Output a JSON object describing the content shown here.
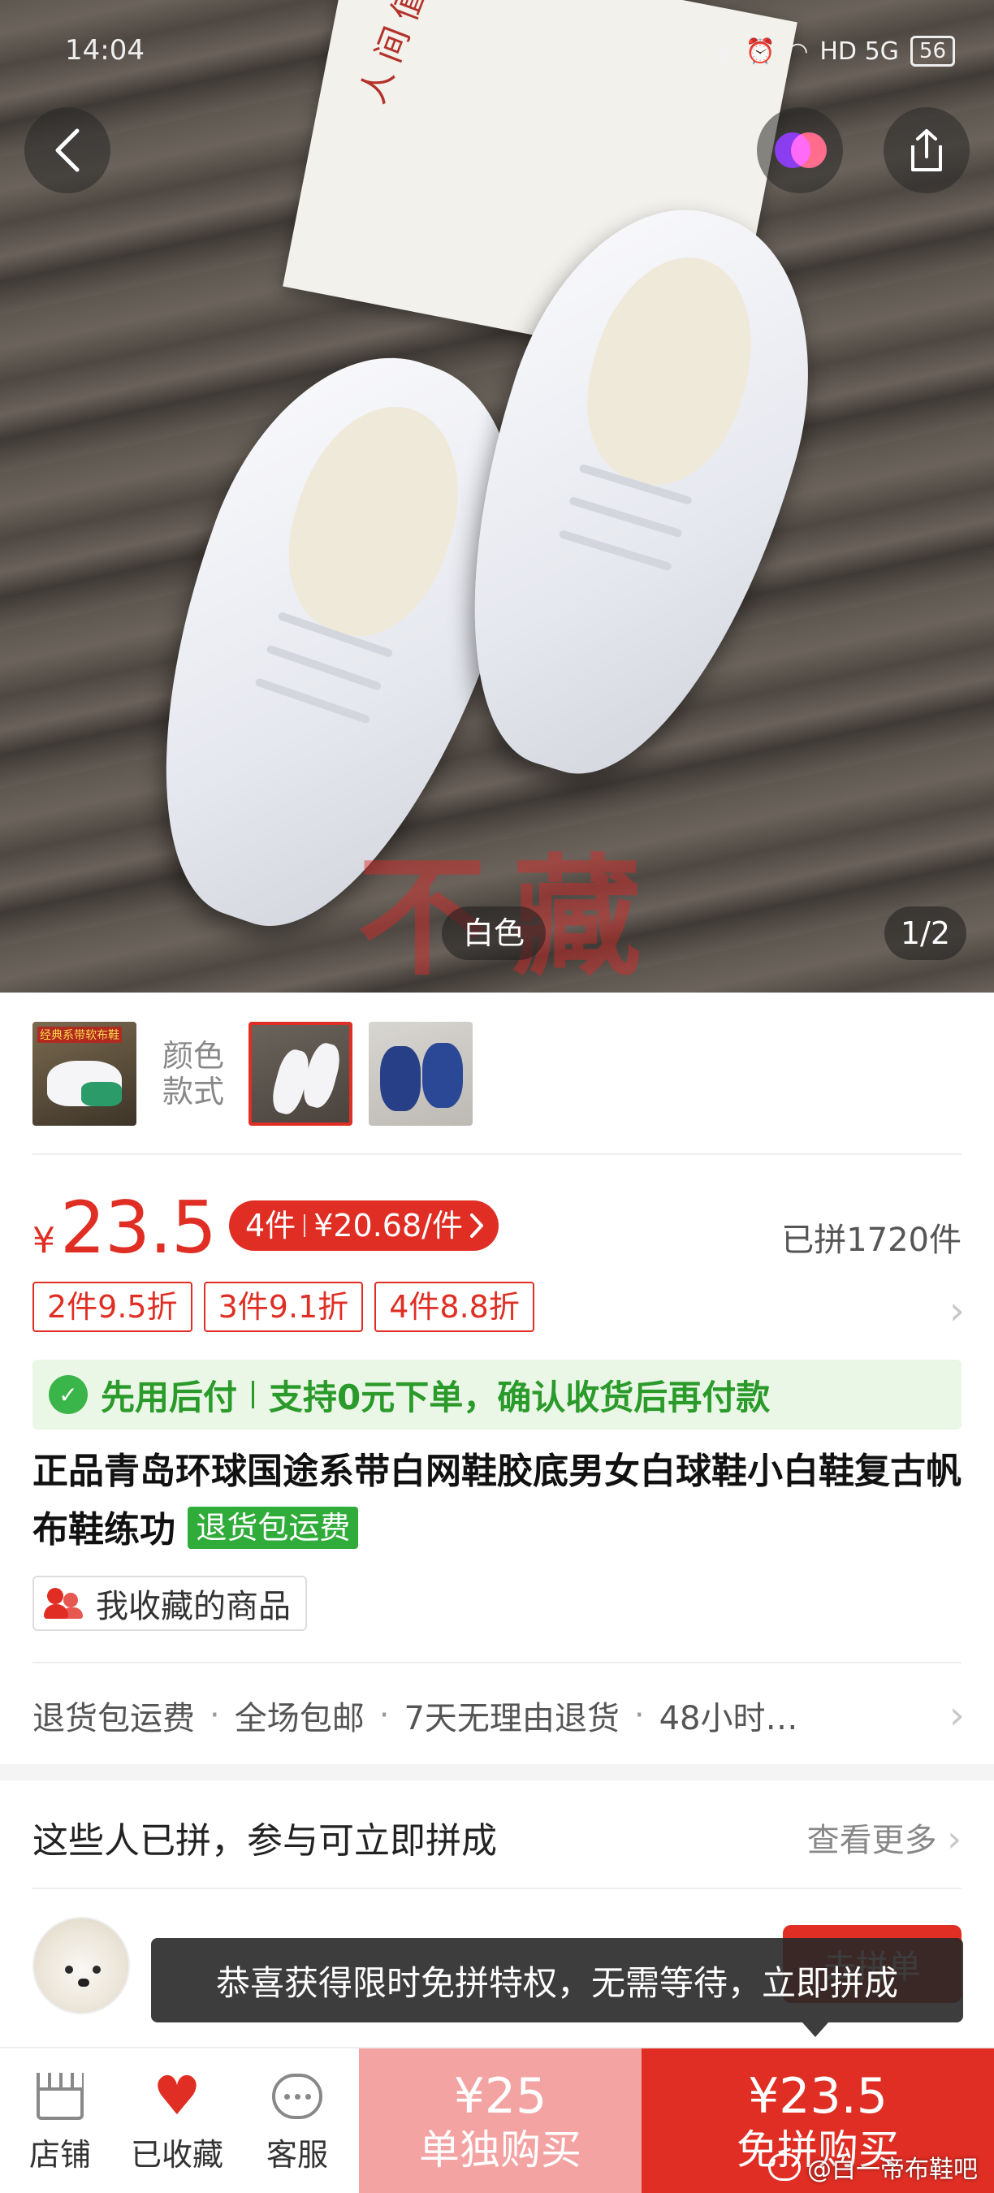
{
  "status_bar": {
    "time": "14:04",
    "network": "HD 5G",
    "battery": "56"
  },
  "hero": {
    "color_tag": "白色",
    "page_indicator": "1/2",
    "watermark": "不藏",
    "book_title": "人间值得"
  },
  "variants": {
    "label": "颜色\n款式",
    "thumb1_caption": "经典系带软布鞋"
  },
  "price": {
    "currency": "¥",
    "value": "23.5",
    "multi_qty": "4件",
    "multi_price": "¥20.68/件",
    "sold": "已拼1720件"
  },
  "discounts": [
    "2件9.5折",
    "3件9.1折",
    "4件8.8折"
  ],
  "pay_later": {
    "title": "先用后付",
    "desc": "支持0元下单，确认收货后再付款"
  },
  "product": {
    "title": "正品青岛环球国途系带白网鞋胶底男女白球鞋小白鞋复古帆布鞋练功",
    "return_tag": "退货包运费"
  },
  "favorite_chip": "我收藏的商品",
  "services": [
    "退货包运费",
    "全场包邮",
    "7天无理由退货",
    "48小时…"
  ],
  "group_section": {
    "title": "这些人已拼，参与可立即拼成",
    "see_more": "查看更多",
    "join_label": "去拼单"
  },
  "toast": "恭喜获得限时免拼特权，无需等待，立即拼成",
  "bottom_bar": {
    "store": "店铺",
    "favorited": "已收藏",
    "service": "客服",
    "solo_price": "¥25",
    "solo_label": "单独购买",
    "group_price": "¥23.5",
    "group_label": "免拼购买"
  },
  "credit": "@白一帝布鞋吧",
  "colors": {
    "accent": "#e02e24",
    "solo_bg": "#f4a3a3",
    "paylater_green": "#2a9a2a"
  }
}
